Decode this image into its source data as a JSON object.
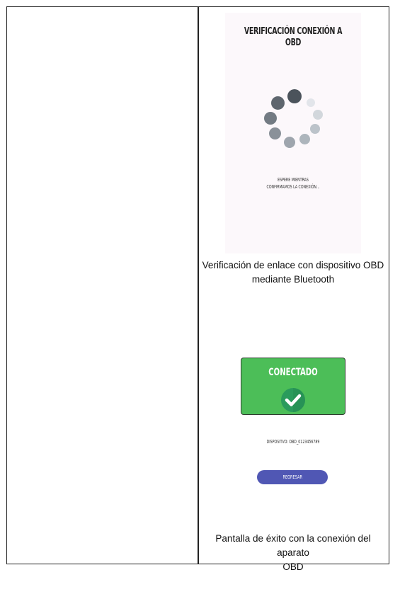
{
  "screen_1": {
    "title": "VERIFICACIÓN CONEXIÓN A OBD",
    "wait_line_1": "ESPERE MIENTRAS",
    "wait_line_2": "CONFIRMAMOS LA CONEXIÓN...",
    "caption_line_1": "Verificación de enlace con dispositivo OBD",
    "caption_line_2": "mediante Bluetooth",
    "spinner_icon": "loading-spinner-icon"
  },
  "screen_2": {
    "status_label": "CONECTADO",
    "check_icon": "check-circle-icon",
    "device_label": "DISPOSITVO: OBD_0123456789",
    "back_button_label": "REGRESAR",
    "caption_line_1": "Pantalla de éxito con la conexión del aparato",
    "caption_line_2": "OBD"
  },
  "colors": {
    "success_green": "#4cbe58",
    "button_blue": "#5057b4",
    "check_dark_green": "#2a9b5c",
    "phone_bg": "#fcf8fb"
  }
}
